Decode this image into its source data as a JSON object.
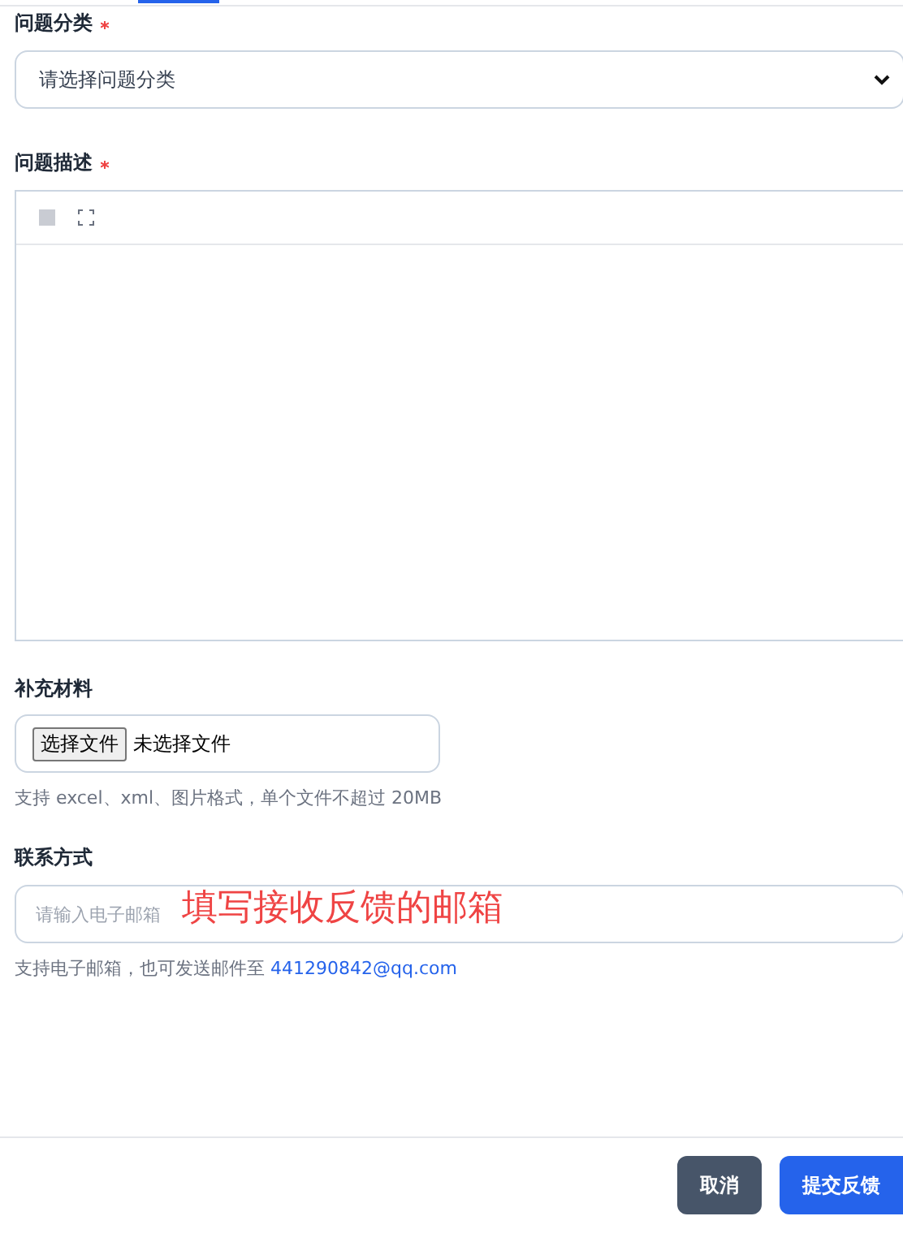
{
  "category": {
    "label": "问题分类",
    "required": true,
    "placeholder": "请选择问题分类"
  },
  "description": {
    "label": "问题描述",
    "required": true
  },
  "attachment": {
    "label": "补充材料",
    "button": "选择文件",
    "status": "未选择文件",
    "hint": "支持 excel、xml、图片格式，单个文件不超过 20MB"
  },
  "contact": {
    "label": "联系方式",
    "required": false,
    "placeholder": "请输入电子邮箱",
    "annotation": "填写接收反馈的邮箱",
    "hint": "支持电子邮箱，也可发送邮件至",
    "email": "441290842@qq.com"
  },
  "buttons": [
    {
      "label": "取消",
      "kind": "secondary"
    },
    {
      "label": "提交反馈",
      "kind": "primary"
    }
  ]
}
